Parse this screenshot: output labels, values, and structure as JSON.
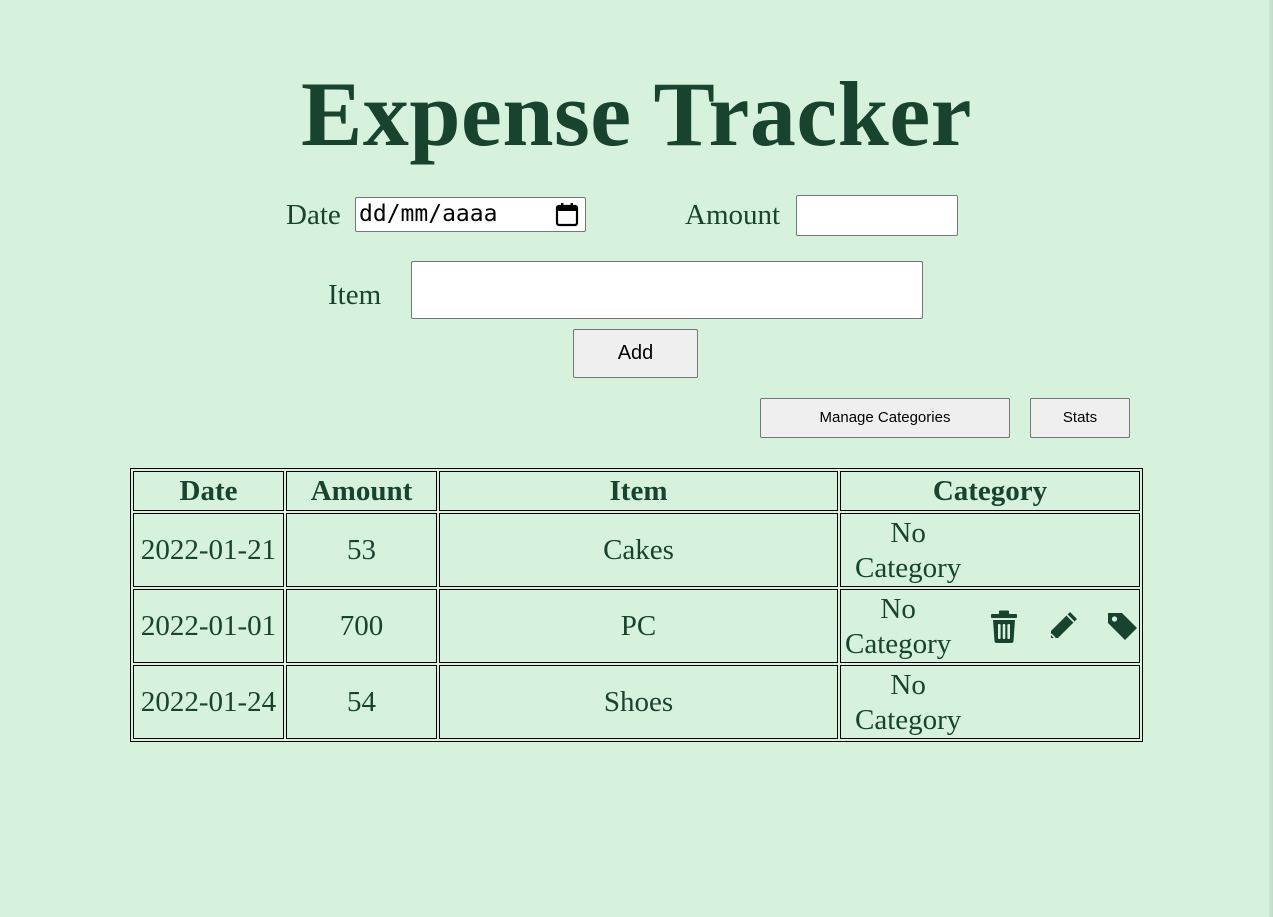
{
  "app": {
    "title": "Expense Tracker"
  },
  "form": {
    "date_label": "Date",
    "date_placeholder": "dd/mm/aaaa",
    "amount_label": "Amount",
    "amount_value": "",
    "item_label": "Item",
    "item_value": "",
    "add_label": "Add"
  },
  "toolbar": {
    "manage_categories_label": "Manage Categories",
    "stats_label": "Stats"
  },
  "table": {
    "headers": {
      "date": "Date",
      "amount": "Amount",
      "item": "Item",
      "category": "Category"
    },
    "rows": [
      {
        "date": "2022-01-21",
        "amount": "53",
        "item": "Cakes",
        "category_line1": "No",
        "category_line2": "Category"
      },
      {
        "date": "2022-01-01",
        "amount": "700",
        "item": "PC",
        "category_line1": "No",
        "category_line2": "Category"
      },
      {
        "date": "2022-01-24",
        "amount": "54",
        "item": "Shoes",
        "category_line1": "No",
        "category_line2": "Category"
      }
    ],
    "row_action_icons": [
      "trash-icon",
      "pencil-icon",
      "tag-icon"
    ]
  },
  "colors": {
    "background": "#d6f2dd",
    "text": "#17432f",
    "button_bg": "#efefef"
  }
}
